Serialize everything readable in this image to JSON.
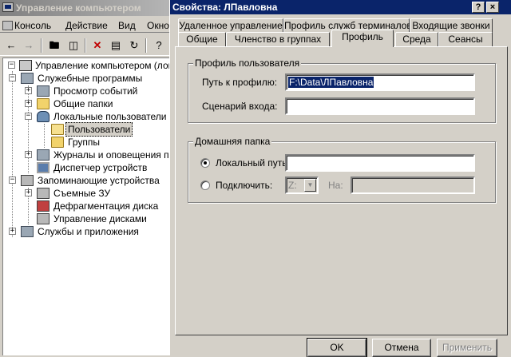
{
  "mmc": {
    "title": "Управление компьютером",
    "menu": [
      "Консоль",
      "Действие",
      "Вид",
      "Окно"
    ],
    "tree": {
      "root": "Управление компьютером (локаль",
      "system_tools": "Служебные программы",
      "event_viewer": "Просмотр событий",
      "shared_folders": "Общие папки",
      "local_users": "Локальные пользователи",
      "users": "Пользователи",
      "groups": "Группы",
      "logs": "Журналы и оповещения пр",
      "device_manager": "Диспетчер устройств",
      "storage": "Запоминающие устройства",
      "removable": "Съемные ЗУ",
      "defrag": "Дефрагментация диска",
      "disk_mgmt": "Управление дисками",
      "services": "Службы и приложения"
    }
  },
  "dialog": {
    "title": "Свойства: ЛПавловна",
    "caption_help": "?",
    "caption_close": "×",
    "tabs_back": [
      "Удаленное управление",
      "Профиль служб терминалов",
      "Входящие звонки"
    ],
    "tabs_front": [
      "Общие",
      "Членство в группах",
      "Профиль",
      "Среда",
      "Сеансы"
    ],
    "active_tab": "Профиль",
    "profile_group": {
      "title": "Профиль пользователя",
      "path_label": "Путь к профилю:",
      "path_value": "F:\\Data\\ЛПавловна",
      "logon_label": "Сценарий входа:",
      "logon_value": ""
    },
    "home_group": {
      "title": "Домашняя папка",
      "local_label": "Локальный путь:",
      "local_value": "",
      "connect_label": "Подключить:",
      "drive_value": "Z:",
      "to_label": "На:",
      "to_value": "",
      "selected": "local"
    },
    "buttons": {
      "ok": "OK",
      "cancel": "Отмена",
      "apply": "Применить"
    }
  }
}
